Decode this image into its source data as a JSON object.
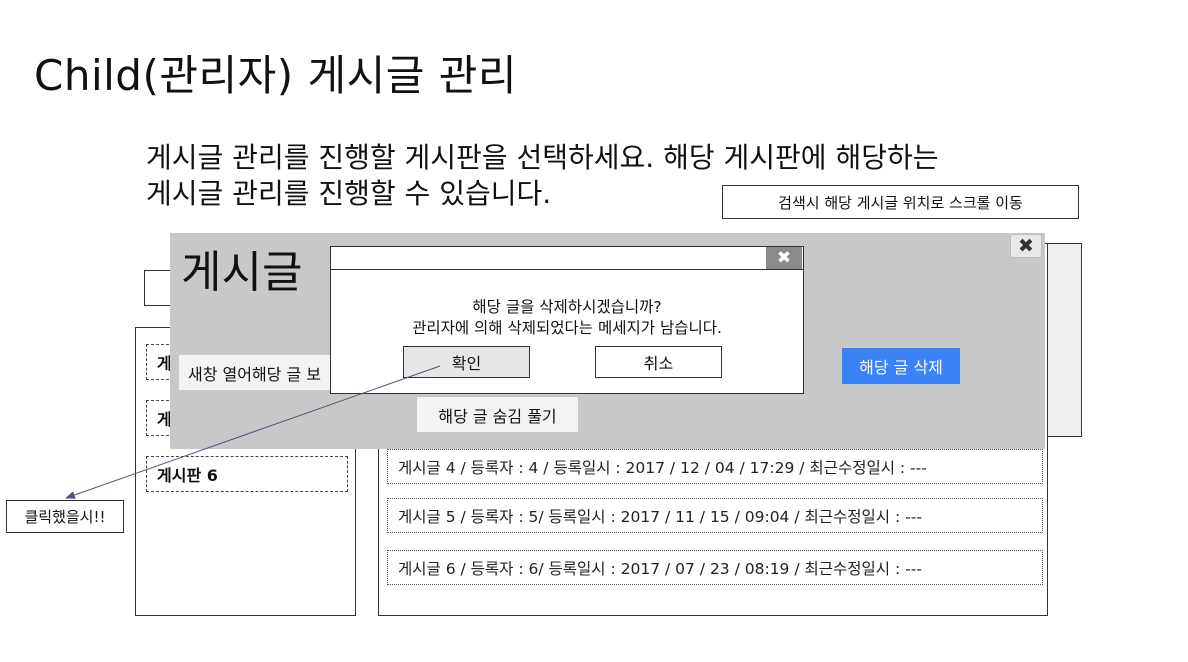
{
  "page": {
    "title": "Child(관리자) 게시글 관리",
    "instruction_line1": "게시글 관리를 진행할 게시판을 선택하세요. 해당 게시판에 해당하는",
    "instruction_line2": "게시글 관리를 진행할 수 있습니다.",
    "scroll_note": "검색시 해당 게시글 위치로 스크롤 이동"
  },
  "board_list": {
    "items": [
      {
        "label": "게"
      },
      {
        "label": "게"
      },
      {
        "label": "게시판 6"
      }
    ]
  },
  "posts": [
    {
      "text": "게시글 4 / 등록자 : 4 / 등록일시 : 2017 / 12 / 04 / 17:29 / 최근수정일시 : ---"
    },
    {
      "text": "게시글 5 / 등록자 : 5/ 등록일시 : 2017 / 11 / 15 / 09:04 / 최근수정일시 : ---"
    },
    {
      "text": "게시글 6 / 등록자 : 6/ 등록일시 : 2017 / 07 / 23 / 08:19 / 최근수정일시 : ---"
    }
  ],
  "popup": {
    "title": "게시글",
    "close_icon": "close-icon",
    "new_window_label": "새창 열어해당 글 보",
    "unhide_label": "해당 글 숨김 풀기",
    "delete_label": "해당 글 삭제",
    "delete_color": "#3b82f6"
  },
  "confirm_dialog": {
    "message_line1": "해당 글을 삭제하시겠습니까?",
    "message_line2": "관리자에 의해 삭제되었다는 메세지가 남습니다.",
    "ok_label": "확인",
    "cancel_label": "취소",
    "close_icon": "close-icon"
  },
  "annotation": {
    "label": "클릭했을시!!"
  }
}
